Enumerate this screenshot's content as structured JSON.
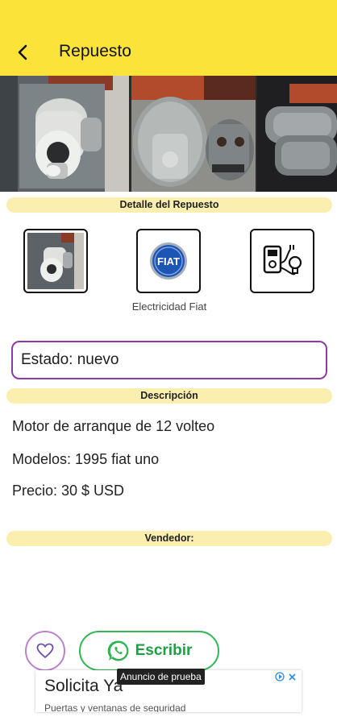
{
  "appbar": {
    "title": "Repuesto",
    "back_icon": "arrow-back-icon"
  },
  "gallery": {
    "photos": [
      "starter-motor-photo-1",
      "starter-motor-photo-2",
      "starter-motor-photo-3"
    ]
  },
  "detail": {
    "section_title": "Detalle del Repuesto",
    "tiles": [
      {
        "name": "part-thumbnail"
      },
      {
        "name": "fiat-logo",
        "caption": "Electricidad Fiat",
        "logo_text": "FIAT"
      },
      {
        "name": "electric-tools-icon"
      }
    ]
  },
  "estado": {
    "text": "Estado: nuevo"
  },
  "descripcion": {
    "section_title": "Descripción",
    "lines": [
      "Motor de arranque de 12 volteo",
      "Modelos: 1995 fiat uno",
      "Precio: 30 $ USD"
    ]
  },
  "vendedor": {
    "section_title": "Vendedor:"
  },
  "actions": {
    "favorite_icon": "heart-icon",
    "write_label": "Escribir",
    "write_icon": "whatsapp-icon"
  },
  "ad": {
    "badge": "Anuncio de prueba",
    "headline": "Solicita Ya",
    "subtext": "Puertas y ventanas de seguridad"
  },
  "colors": {
    "appbar": "#fce33a",
    "pill": "#fbefb0",
    "field_border": "#8e3aa6",
    "whatsapp": "#35b558"
  }
}
